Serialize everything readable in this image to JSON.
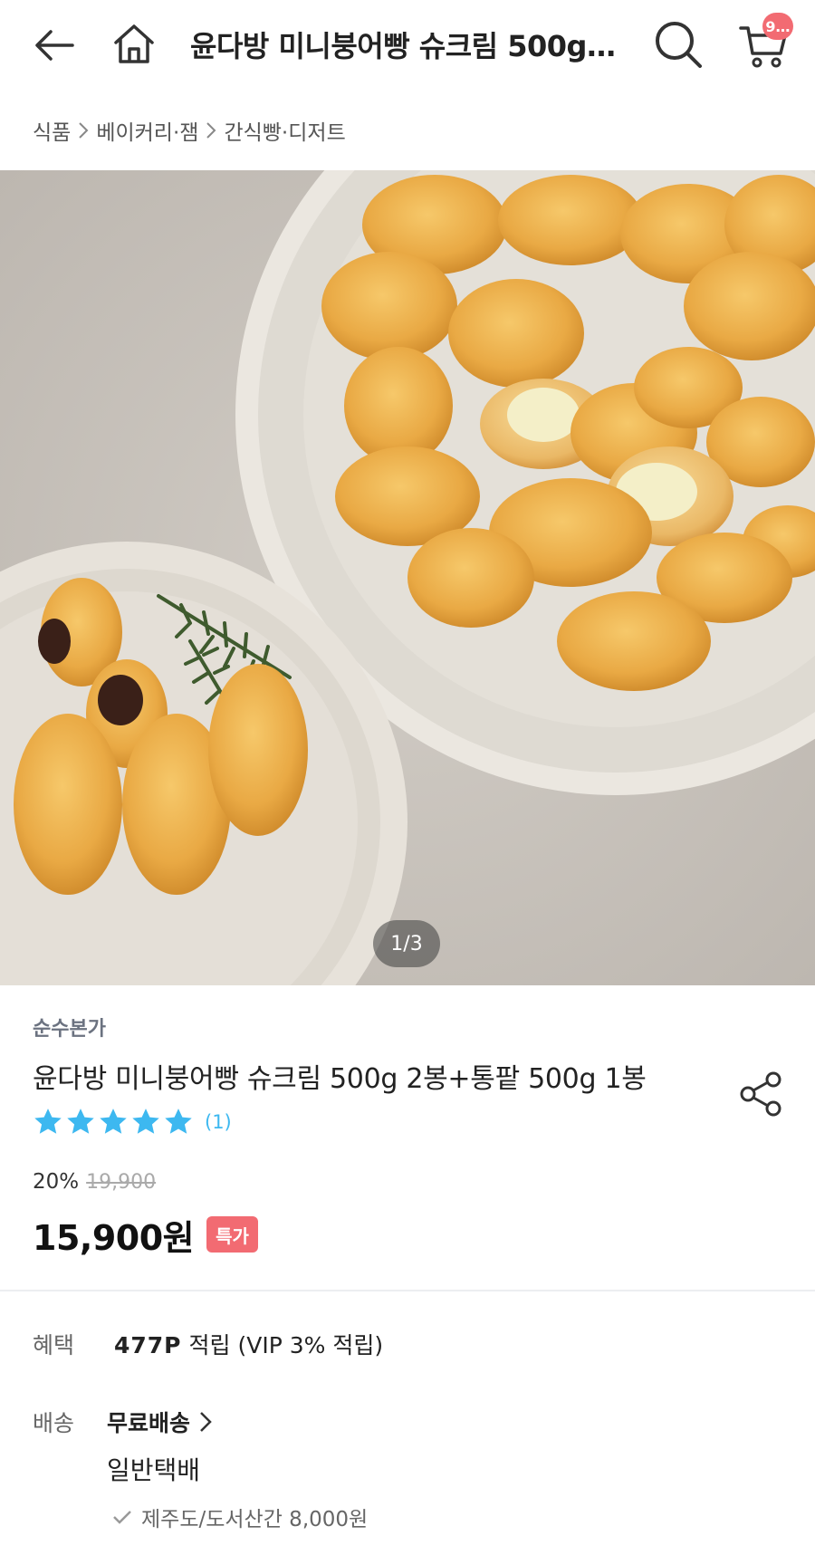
{
  "header": {
    "title": "윤다방 미니붕어빵 슈크림 500g 2봉+통팥 500g 1봉",
    "cart_badge": "9…",
    "icons": [
      "back-arrow-icon",
      "home-icon",
      "search-icon",
      "cart-icon"
    ]
  },
  "breadcrumb": [
    "식품",
    "베이커리·잼",
    "간식빵·디저트"
  ],
  "gallery": {
    "indicator": "1/3"
  },
  "product": {
    "brand": "순수본가",
    "name": "윤다방 미니붕어빵 슈크림 500g 2봉+통팥 500g 1봉",
    "rating_stars": 5,
    "rating_count": "(1)",
    "discount_rate": "20%",
    "original_price": "19,900",
    "sale_price": "15,900원",
    "special_tag": "특가"
  },
  "benefit": {
    "label": "혜택",
    "points": "477P",
    "text": "적립 (VIP 3% 적립)"
  },
  "shipping": {
    "label": "배송",
    "free": "무료배송",
    "type": "일반택배",
    "note": "제주도/도서산간 8,000원"
  },
  "colors": {
    "accent_red": "#f26b72",
    "star_blue": "#3db8f0",
    "text_dark": "#222222"
  }
}
